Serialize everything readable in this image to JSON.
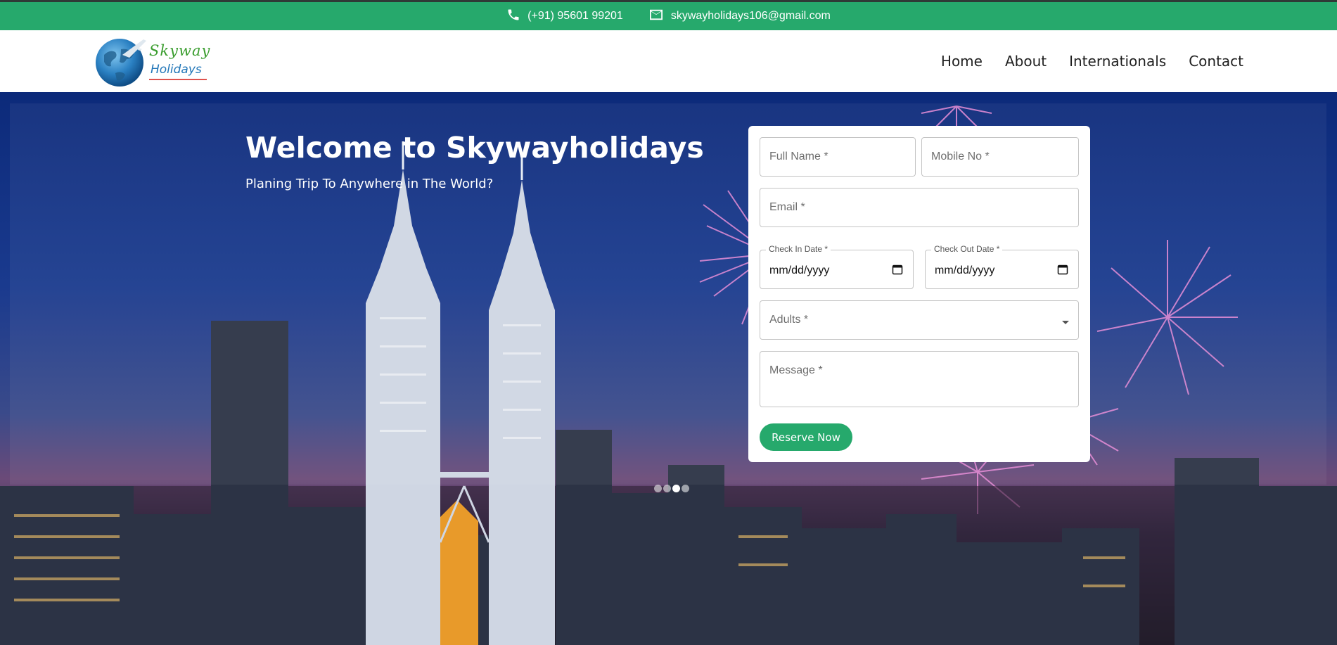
{
  "topbar": {
    "phone": "(+91) 95601 99201",
    "email": "skywayholidays106@gmail.com"
  },
  "logo": {
    "line1": "Skyway",
    "line2": "Holidays"
  },
  "nav": {
    "items": [
      "Home",
      "About",
      "Internationals",
      "Contact"
    ]
  },
  "hero": {
    "title": "Welcome to Skywayholidays",
    "subtitle": "Planing Trip To Anywhere in The World?"
  },
  "form": {
    "full_name_placeholder": "Full Name *",
    "mobile_placeholder": "Mobile No *",
    "email_placeholder": "Email *",
    "checkin_label": "Check In Date *",
    "checkin_value": "mm/dd/yyyy",
    "checkout_label": "Check Out Date *",
    "checkout_value": "mm/dd/yyyy",
    "adults_placeholder": "Adults *",
    "message_placeholder": "Message *",
    "submit_label": "Reserve Now"
  },
  "colors": {
    "accent": "#26a96c",
    "logo_green": "#3a9d2e",
    "logo_blue": "#2176b8"
  },
  "carousel": {
    "active_index": 2,
    "dot_count": 4
  }
}
